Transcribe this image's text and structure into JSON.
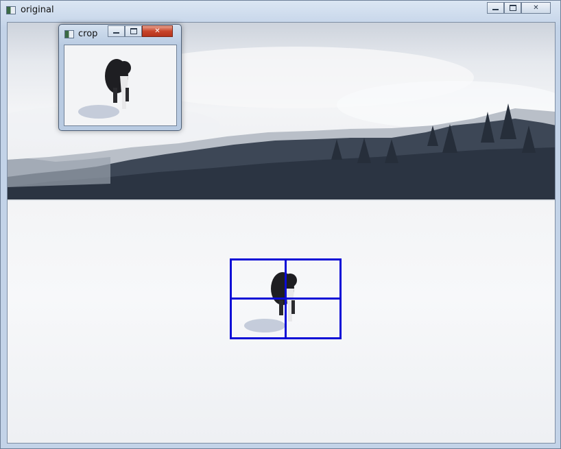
{
  "main_window": {
    "title": "original",
    "controls": {
      "minimize": "minimize",
      "maximize": "maximize",
      "close": "close"
    }
  },
  "crop_window": {
    "title": "crop",
    "controls": {
      "minimize": "minimize",
      "maximize": "maximize",
      "close": "close"
    }
  },
  "icons": {
    "window": "window-icon",
    "minimize": "minimize-icon",
    "maximize": "maximize-icon",
    "close": "close-icon"
  },
  "colors": {
    "grid_lines": "#0b0bd6",
    "close_button_active": "#c8452b"
  }
}
